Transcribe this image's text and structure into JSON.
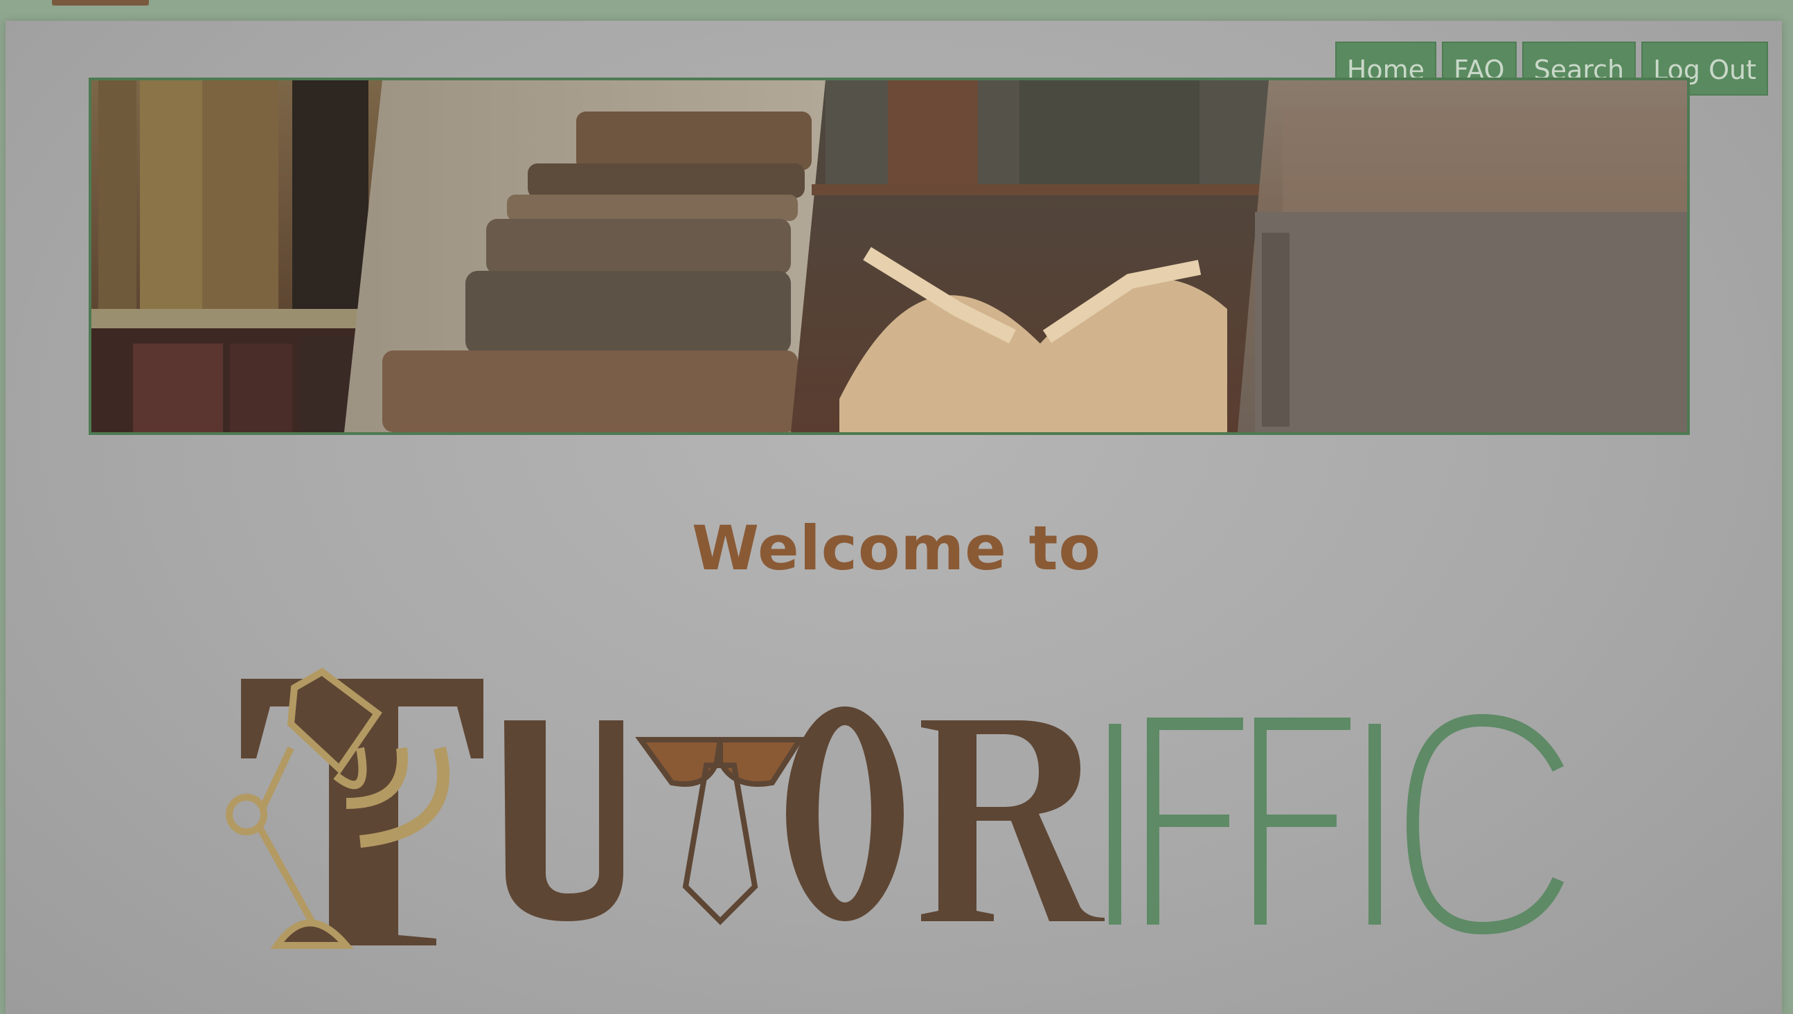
{
  "nav": {
    "items": [
      {
        "label": "Home"
      },
      {
        "label": "FAQ"
      },
      {
        "label": "Search"
      },
      {
        "label": "Log Out"
      }
    ]
  },
  "banner": {
    "panels": [
      "old-books-shelf",
      "stacked-books",
      "open-book",
      "book-spine-closeup"
    ]
  },
  "hero": {
    "welcome": "Welcome to"
  },
  "logo": {
    "brand_text_dark": "TUTOR",
    "brand_text_light": "IFFIC",
    "colors": {
      "dark": "#5e4634",
      "gold": "#b39a63",
      "green": "#5e8a66",
      "tie": "#8a5a35"
    }
  },
  "colors": {
    "nav_bg": "#5a8a5f",
    "nav_text": "#c9d8c9",
    "banner_border": "#4e7a52",
    "welcome_text": "#8a5a35"
  }
}
